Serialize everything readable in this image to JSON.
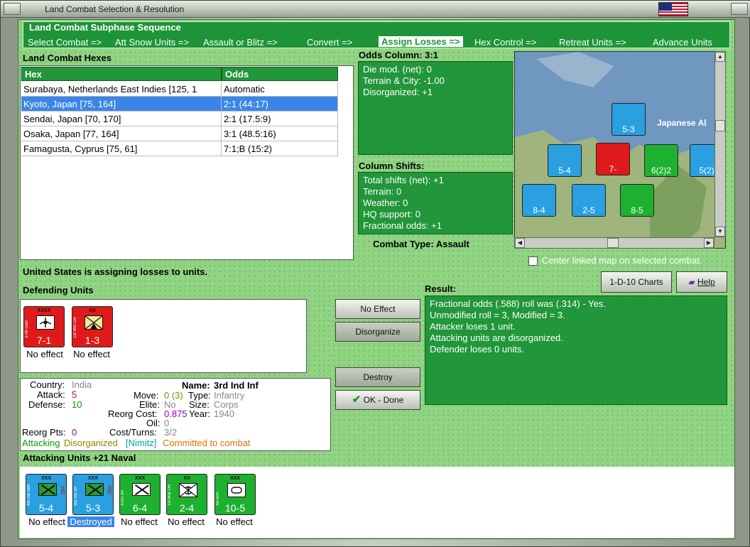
{
  "window": {
    "title": "Land Combat Selection & Resolution"
  },
  "sequence": {
    "title": "Land Combat Subphase Sequence",
    "steps": [
      "Select Combat =>",
      "Att Snow Units =>",
      "Assault or Blitz =>",
      "Convert =>",
      "Assign Losses =>",
      "Hex Control =>",
      "Retreat Units =>",
      "Advance Units"
    ],
    "active": "Assign Losses =>"
  },
  "hexes": {
    "title": "Land Combat Hexes",
    "columns": [
      "Hex",
      "Odds"
    ],
    "rows": [
      [
        "Surabaya, Netherlands East Indies [125, 1",
        "Automatic"
      ],
      [
        "Kyoto, Japan [75, 164]",
        "2:1 (44:17)"
      ],
      [
        "Sendai, Japan [70, 170]",
        "2:1 (17.5:9)"
      ],
      [
        "Osaka, Japan [77, 164]",
        "3:1 (48.5:16)"
      ],
      [
        "Famagusta, Cyprus [75, 61]",
        "7:1;B (15:2)"
      ]
    ]
  },
  "odds": {
    "title": "Odds Column: 3:1",
    "lines": [
      "Die mod. (net): 0",
      "Terrain & City: -1.00",
      "Disorganized: +1"
    ]
  },
  "shifts": {
    "title": "Column Shifts:",
    "lines": [
      "Total shifts (net): +1",
      "Terrain: 0",
      "Weather: 0",
      "HQ support: 0",
      "Fractional odds: +1"
    ]
  },
  "combat_type": "Combat Type:  Assault",
  "map": {
    "label": "Japanese Al",
    "center_checkbox": "Center linked map on selected combat."
  },
  "status": "United States is assigning losses to units.",
  "defending": {
    "title": "Defending Units",
    "units": [
      {
        "code": "XXXX",
        "side": "37th Garr",
        "stat": "7-1",
        "label": "No effect",
        "symbol": "garrison"
      },
      {
        "code": "XX",
        "side": "1st Mtn Div",
        "stat": "1-3",
        "label": "No effect",
        "symbol": "mountain"
      }
    ]
  },
  "buttons": {
    "charts": "1-D-10 Charts",
    "help": "Help",
    "no_effect": "No Effect",
    "disorganize": "Disorganize",
    "destroy": "Destroy",
    "ok": "OK - Done"
  },
  "result": {
    "title": "Result:",
    "lines": [
      "Fractional odds (.588) roll was (.314)  - Yes.",
      "Unmodified roll = 3, Modified = 3.",
      "Attacker loses 1 unit.",
      "Attacking units are disorganized.",
      "Defender loses 0 units."
    ]
  },
  "unit_info": {
    "country_label": "Country:",
    "country": "India",
    "attack_label": "Attack:",
    "attack": "5",
    "defense_label": "Defense:",
    "defense": "10",
    "name_label": "Name:",
    "name": "3rd Ind Inf",
    "move_label": "Move:",
    "move": "0 (3)",
    "type_label": "Type:",
    "type": "Infantry",
    "elite_label": "Elite:",
    "elite": "No",
    "size_label": "Size:",
    "size": "Corps",
    "reorg_cost_label": "Reorg Cost:",
    "reorg_cost": "0.875",
    "year_label": "Year:",
    "year": "1940",
    "oil_label": "Oil:",
    "oil": "0",
    "reorg_pts_label": "Reorg Pts:",
    "reorg_pts": "0",
    "cost_turns_label": "Cost/Turns:",
    "cost_turns": "3/2",
    "attacking": "Attacking",
    "disorganized": "Disorganized",
    "nimitz": "[Nimitz]",
    "committed": "Committed to combat"
  },
  "attacking": {
    "title": "Attacking Units +21 Naval",
    "units": [
      {
        "code": "XXX",
        "side": "4th Ind Mot",
        "stat": "5-4",
        "label": "No effect",
        "color": "blue",
        "ind": "IND"
      },
      {
        "code": "XXX",
        "side": "3rd Ind Inf",
        "stat": "5-3",
        "label": "Destroyed",
        "color": "blue",
        "ind": "IND"
      },
      {
        "code": "XXX",
        "side": "XXIV Inf",
        "stat": "6-4",
        "label": "No effect",
        "color": "green",
        "ind": ""
      },
      {
        "code": "XX",
        "side": "1st Mar Div",
        "stat": "2-4",
        "label": "No effect",
        "color": "green",
        "ind": ""
      },
      {
        "code": "XXX",
        "side": "XII Arm",
        "stat": "10-5",
        "label": "No effect",
        "color": "green",
        "ind": ""
      }
    ]
  }
}
